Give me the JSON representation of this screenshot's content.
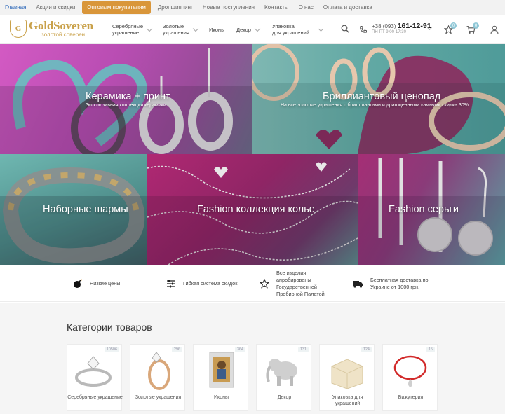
{
  "topnav": {
    "items": [
      "Главная",
      "Акции и скидки",
      "Оптовым покупателям",
      "Дропшиппинг",
      "Новые поступления",
      "Контакты",
      "О нас",
      "Оплата и доставка"
    ]
  },
  "header": {
    "logo_name": "GoldSoveren",
    "logo_sub": "золотой соверен",
    "menu": [
      {
        "l1": "Серебряные",
        "l2": "украшение"
      },
      {
        "l1": "Золотые",
        "l2": "украшения"
      },
      {
        "l1": "Иконы",
        "l2": ""
      },
      {
        "l1": "Декор",
        "l2": ""
      },
      {
        "l1": "Упаковка",
        "l2": "для украшений"
      }
    ],
    "phone_prefix": "+38 (093)",
    "phone_number": "161-12-91",
    "hours": "ПН-ПТ 9:00-17:30",
    "wishlist_count": "0",
    "cart_count": "0"
  },
  "banners": [
    {
      "title": "Керамика + принт",
      "subtitle": "Эксклюзивная коллекция керамики"
    },
    {
      "title": "Бриллиантовый ценопад",
      "subtitle": "На все золотые украшения с бриллиантами и драгоценными камнями скидка 30%"
    },
    {
      "title": "Наборные шармы",
      "subtitle": ""
    },
    {
      "title": "Fashion коллекция колье",
      "subtitle": ""
    },
    {
      "title": "Fashion серьги",
      "subtitle": ""
    }
  ],
  "features": [
    {
      "icon": "bomb-icon",
      "text": "Низкие цены"
    },
    {
      "icon": "sliders-icon",
      "text": "Гибкая система скидок"
    },
    {
      "icon": "star-icon",
      "text": "Все изделия апробированы Государственной Пробирной Палатой"
    },
    {
      "icon": "truck-icon",
      "text": "Бесплатная доставка по Украине от 1000 грн."
    }
  ],
  "categories": {
    "heading": "Категории товаров",
    "items": [
      {
        "label": "Серебряные украшение",
        "count": "10506"
      },
      {
        "label": "Золотые украшения",
        "count": "296"
      },
      {
        "label": "Иконы",
        "count": "364"
      },
      {
        "label": "Декор",
        "count": "131"
      },
      {
        "label": "Упаковка для украшений",
        "count": "124"
      },
      {
        "label": "Бижутерия",
        "count": "15"
      }
    ]
  },
  "colors": {
    "accent": "#d9963a",
    "active_link": "#2a66b8",
    "gold": "#c9a14a",
    "magenta": "#b02873",
    "teal": "#5aa9a4"
  }
}
